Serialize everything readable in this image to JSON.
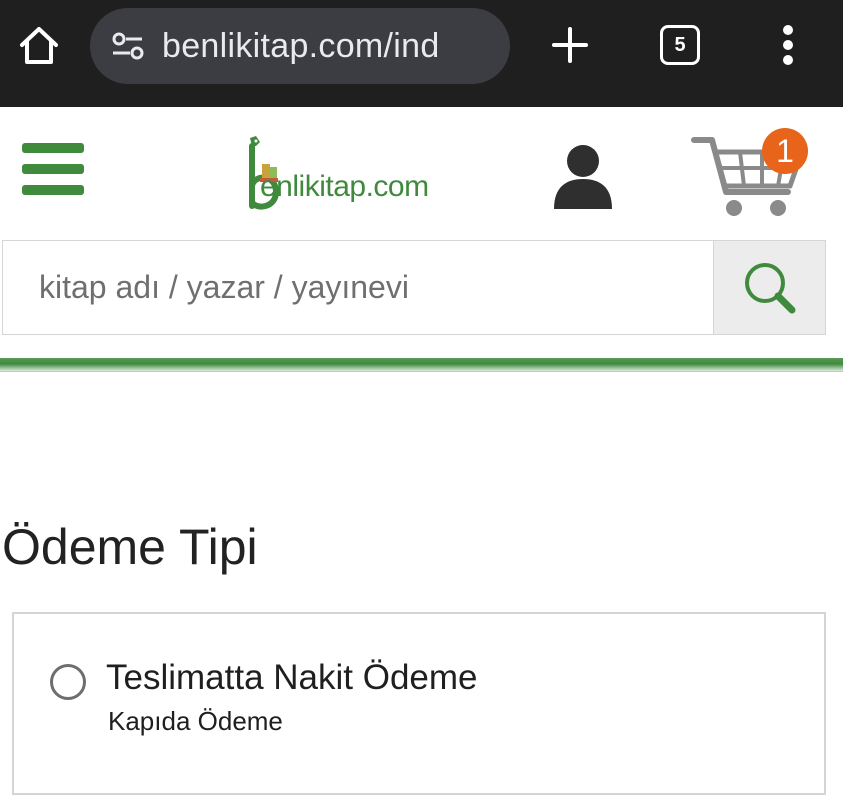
{
  "browser": {
    "url": "benlikitap.com/ind",
    "tab_count": "5"
  },
  "site": {
    "logo_text": "enlikitap.com",
    "cart_count": "1",
    "brand_color": "#3f8a3d",
    "badge_color": "#e8641b"
  },
  "search": {
    "placeholder": "kitap adı / yazar / yayınevi",
    "value": ""
  },
  "payment": {
    "section_title": "Ödeme Tipi",
    "options": [
      {
        "title": "Teslimatta Nakit Ödeme",
        "subtitle": "Kapıda Ödeme",
        "selected": false
      }
    ]
  }
}
